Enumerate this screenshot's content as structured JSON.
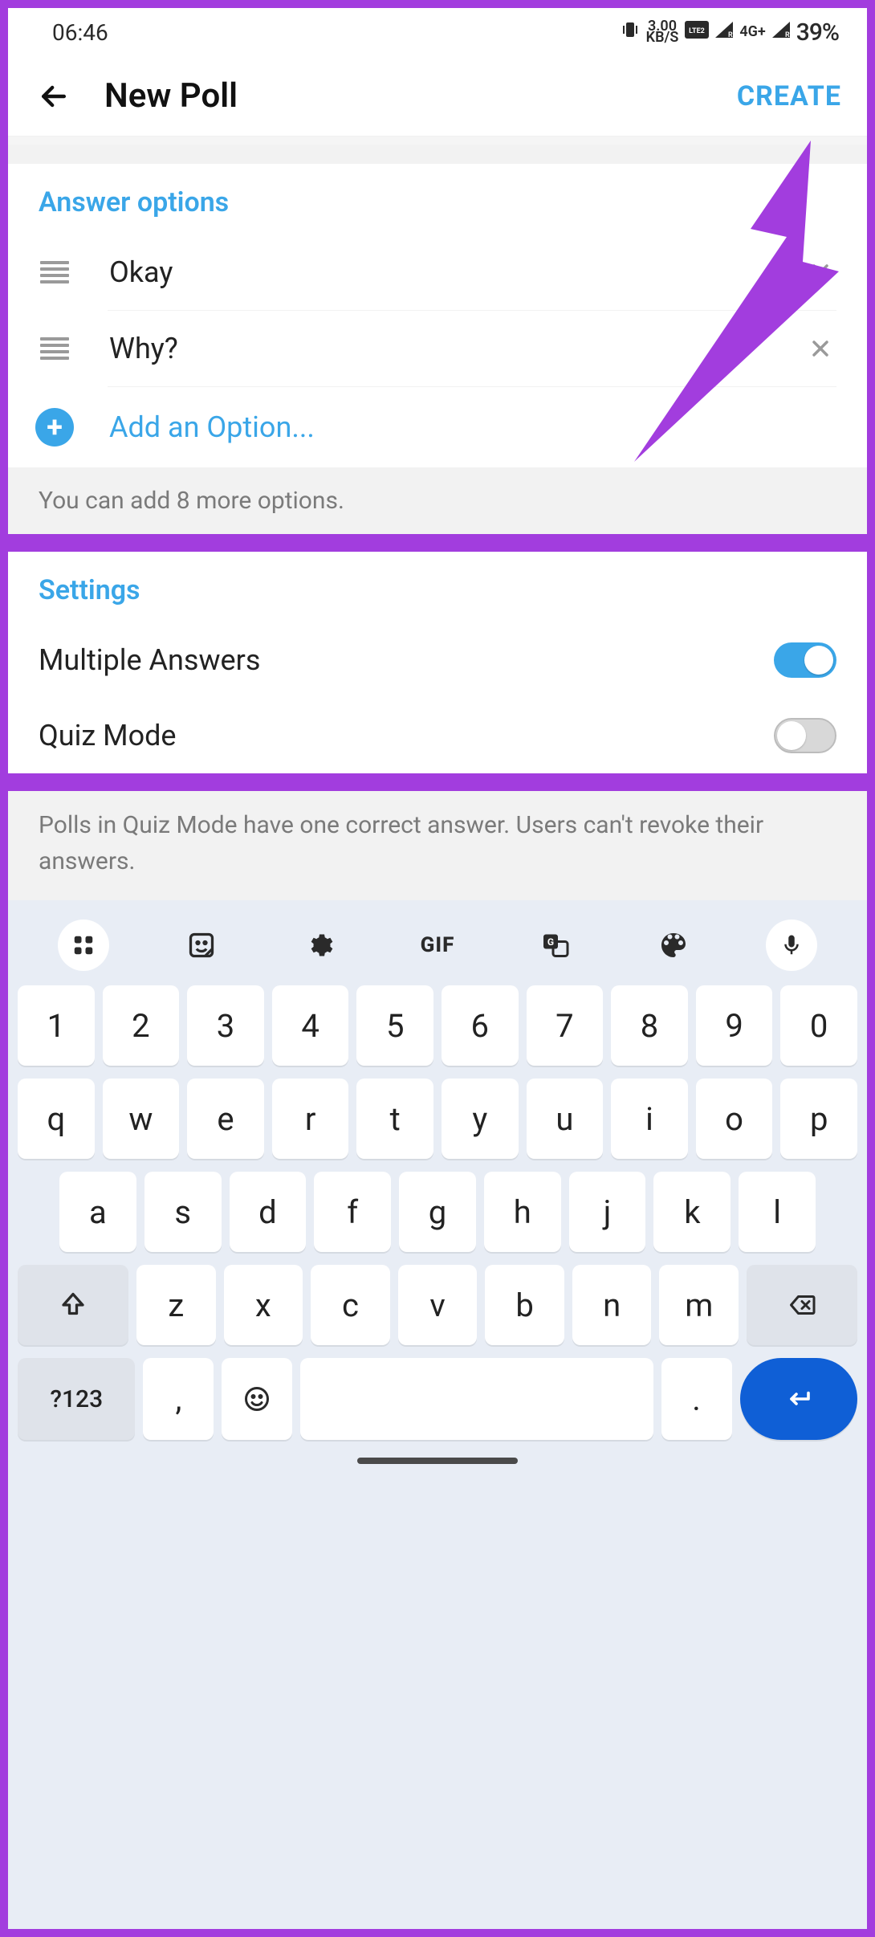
{
  "status_bar": {
    "time": "06:46",
    "net_speed_value": "3.00",
    "net_speed_unit": "KB/S",
    "volte_label": "VoLTE2",
    "net_type": "4G+",
    "battery": "39%"
  },
  "app_bar": {
    "title": "New Poll",
    "create_label": "CREATE"
  },
  "answer_options": {
    "header": "Answer options",
    "items": [
      {
        "text": "Okay"
      },
      {
        "text": "Why?"
      }
    ],
    "add_label": "Add an Option...",
    "hint": "You can add 8 more options."
  },
  "settings": {
    "header": "Settings",
    "multiple_answers_label": "Multiple Answers",
    "multiple_answers_on": true,
    "quiz_mode_label": "Quiz Mode",
    "quiz_mode_on": false,
    "quiz_hint": "Polls in Quiz Mode have one correct answer. Users can't revoke their answers."
  },
  "keyboard": {
    "toolbar_gif": "GIF",
    "row_numbers": [
      "1",
      "2",
      "3",
      "4",
      "5",
      "6",
      "7",
      "8",
      "9",
      "0"
    ],
    "row_q": [
      "q",
      "w",
      "e",
      "r",
      "t",
      "y",
      "u",
      "i",
      "o",
      "p"
    ],
    "row_a": [
      "a",
      "s",
      "d",
      "f",
      "g",
      "h",
      "j",
      "k",
      "l"
    ],
    "row_z": [
      "z",
      "x",
      "c",
      "v",
      "b",
      "n",
      "m"
    ],
    "num_label": "?123",
    "comma": ",",
    "period": "."
  },
  "colors": {
    "accent": "#3aa6e8",
    "frame": "#a23dde",
    "enter": "#0f5fd6"
  }
}
